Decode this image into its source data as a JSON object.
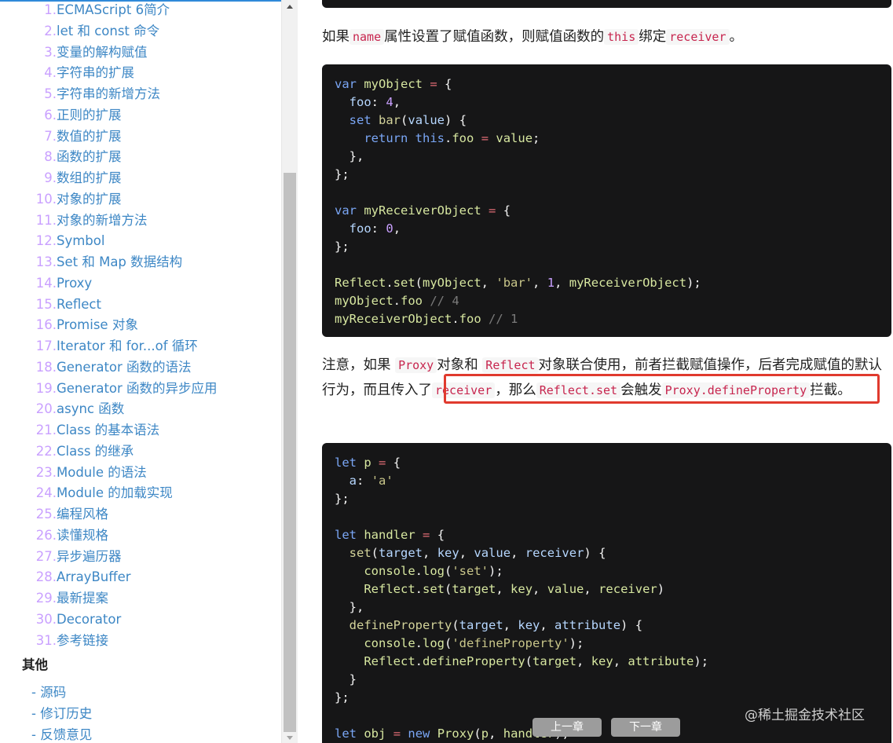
{
  "sidebar": {
    "toc": [
      {
        "num": "1.",
        "label": "ECMAScript 6简介"
      },
      {
        "num": "2.",
        "label": "let 和 const 命令"
      },
      {
        "num": "3.",
        "label": "变量的解构赋值"
      },
      {
        "num": "4.",
        "label": "字符串的扩展"
      },
      {
        "num": "5.",
        "label": "字符串的新增方法"
      },
      {
        "num": "6.",
        "label": "正则的扩展"
      },
      {
        "num": "7.",
        "label": "数值的扩展"
      },
      {
        "num": "8.",
        "label": "函数的扩展"
      },
      {
        "num": "9.",
        "label": "数组的扩展"
      },
      {
        "num": "10.",
        "label": "对象的扩展"
      },
      {
        "num": "11.",
        "label": "对象的新增方法"
      },
      {
        "num": "12.",
        "label": "Symbol"
      },
      {
        "num": "13.",
        "label": "Set 和 Map 数据结构"
      },
      {
        "num": "14.",
        "label": "Proxy"
      },
      {
        "num": "15.",
        "label": "Reflect"
      },
      {
        "num": "16.",
        "label": "Promise 对象"
      },
      {
        "num": "17.",
        "label": "Iterator 和 for...of 循环"
      },
      {
        "num": "18.",
        "label": "Generator 函数的语法"
      },
      {
        "num": "19.",
        "label": "Generator 函数的异步应用"
      },
      {
        "num": "20.",
        "label": "async 函数"
      },
      {
        "num": "21.",
        "label": "Class 的基本语法"
      },
      {
        "num": "22.",
        "label": "Class 的继承"
      },
      {
        "num": "23.",
        "label": "Module 的语法"
      },
      {
        "num": "24.",
        "label": "Module 的加载实现"
      },
      {
        "num": "25.",
        "label": "编程风格"
      },
      {
        "num": "26.",
        "label": "读懂规格"
      },
      {
        "num": "27.",
        "label": "异步遍历器"
      },
      {
        "num": "28.",
        "label": "ArrayBuffer"
      },
      {
        "num": "29.",
        "label": "最新提案"
      },
      {
        "num": "30.",
        "label": "Decorator"
      },
      {
        "num": "31.",
        "label": "参考链接"
      }
    ],
    "other_title": "其他",
    "other_items": [
      "- 源码",
      "- 修订历史",
      "- 反馈意见"
    ]
  },
  "content": {
    "para1": {
      "t1": "如果",
      "c1": "name",
      "t2": "属性设置了赋值函数，则赋值函数的",
      "c2": "this",
      "t3": "绑定",
      "c3": "receiver",
      "t4": "。"
    },
    "para2": {
      "t1": "注意，如果 ",
      "c1": "Proxy",
      "t2": "对象和 ",
      "c2": "Reflect",
      "t3": "对象联合使用，前者拦截赋值操作，后者完成赋值的默认行为，而且传入了",
      "c3": "receiver",
      "t4": "，那么",
      "c4": "Reflect.set",
      "t5": "会触发",
      "c5": "Proxy.defineProperty",
      "t6": "拦截。"
    }
  },
  "nav": {
    "prev": "上一章",
    "next": "下一章"
  },
  "watermark": "@稀土掘金技术社区",
  "colors": {
    "link": "#3d87c5",
    "code_bg": "#161617",
    "inline_code": "#c7254e",
    "highlight_box": "#e03a2e"
  }
}
